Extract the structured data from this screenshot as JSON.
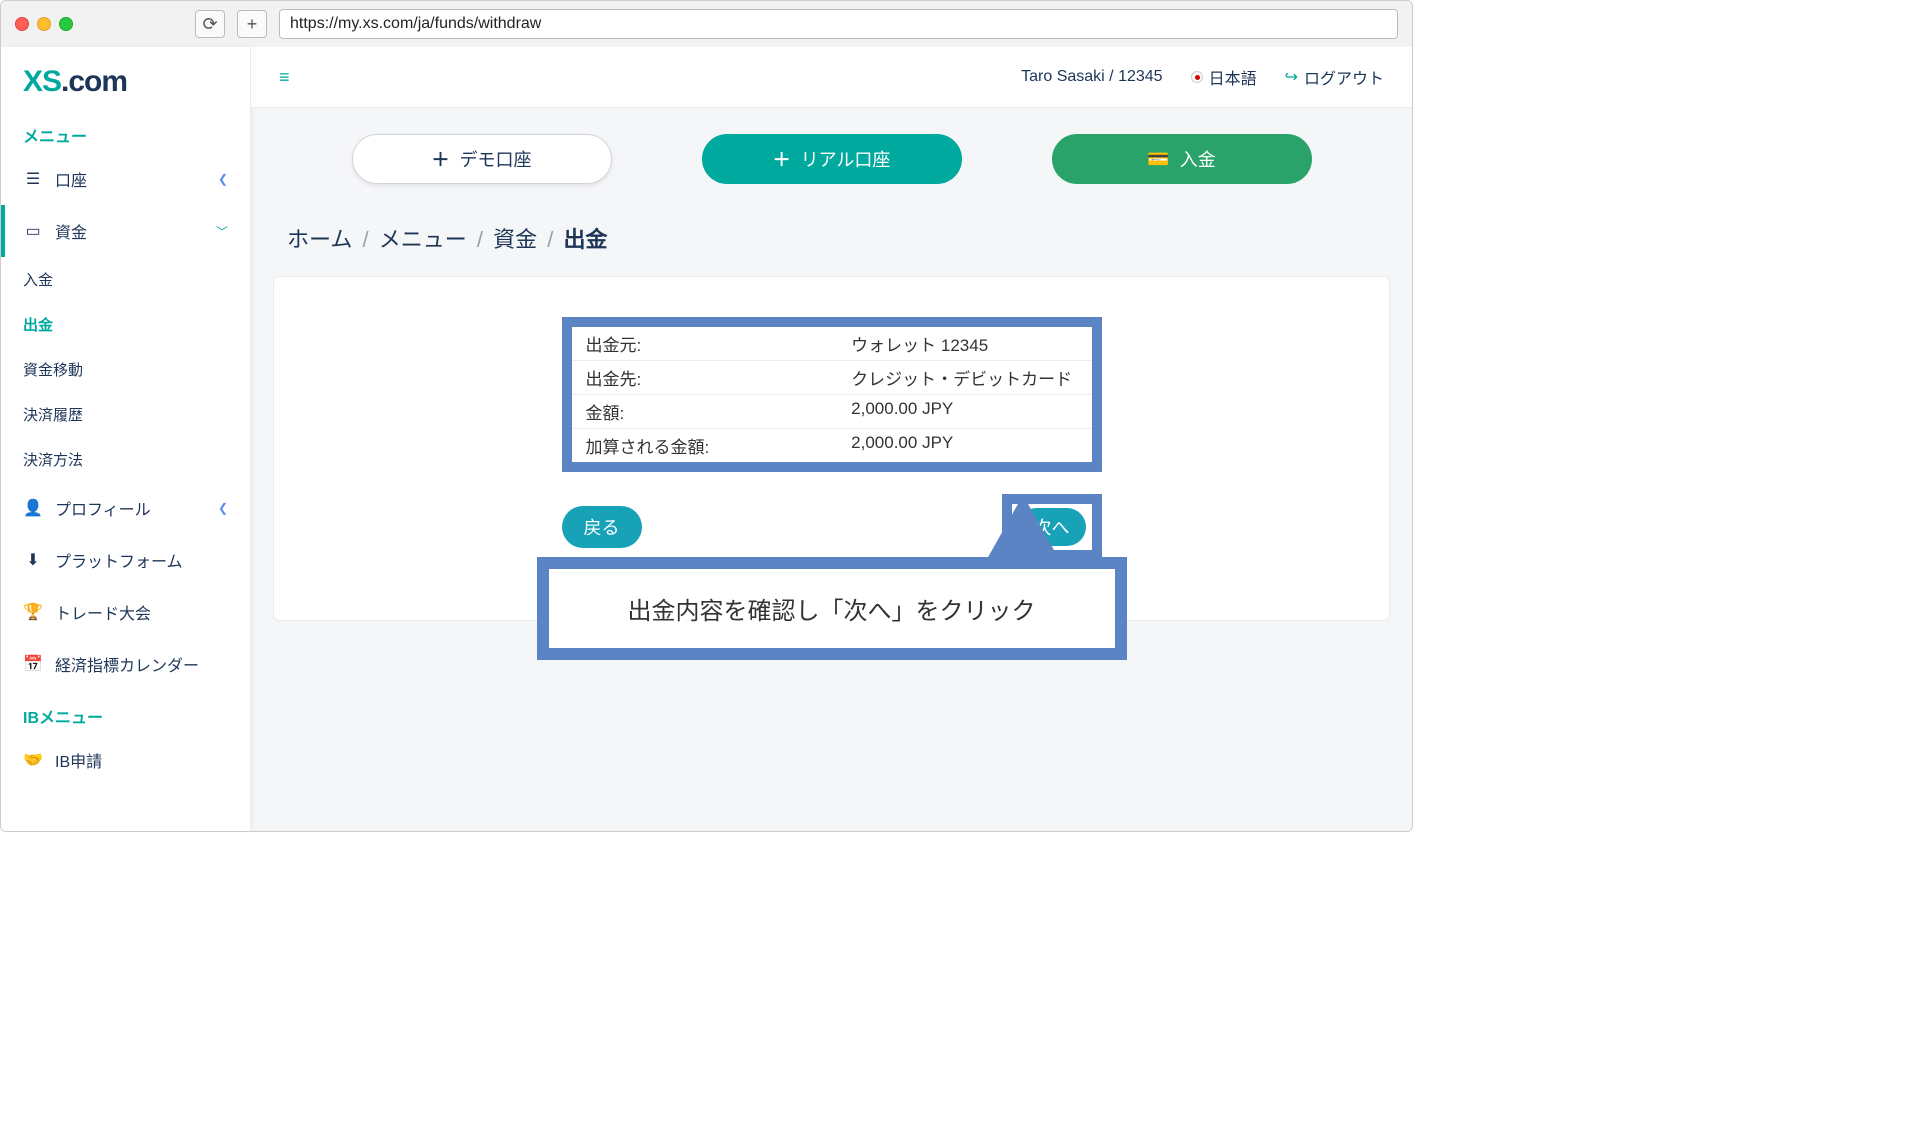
{
  "browser": {
    "url": "https://my.xs.com/ja/funds/withdraw"
  },
  "logo": {
    "xs": "XS",
    "dotcom": ".com"
  },
  "sidebar": {
    "heading_main": "メニュー",
    "heading_ib": "IBメニュー",
    "accounts": "口座",
    "funds": "資金",
    "sub_deposit": "入金",
    "sub_withdraw": "出金",
    "sub_transfer": "資金移動",
    "sub_history": "決済履歴",
    "sub_methods": "決済方法",
    "profile": "プロフィール",
    "platform": "プラットフォーム",
    "contest": "トレード大会",
    "calendar": "経済指標カレンダー",
    "ib_apply": "IB申請"
  },
  "topbar": {
    "user": "Taro Sasaki / 12345",
    "language": "日本語",
    "logout": "ログアウト"
  },
  "actions": {
    "demo": "デモ口座",
    "real": "リアル口座",
    "deposit": "入金"
  },
  "breadcrumb": {
    "home": "ホーム",
    "menu": "メニュー",
    "funds": "資金",
    "current": "出金"
  },
  "summary": {
    "rows": [
      {
        "label": "出金元:",
        "value": "ウォレット 12345"
      },
      {
        "label": "出金先:",
        "value": "クレジット・デビットカード"
      },
      {
        "label": "金額:",
        "value": "2,000.00 JPY"
      },
      {
        "label": "加算される金額:",
        "value": "2,000.00 JPY"
      }
    ]
  },
  "buttons": {
    "back": "戻る",
    "next": "次へ"
  },
  "callout": {
    "text": "出金内容を確認し「次へ」をクリック"
  }
}
